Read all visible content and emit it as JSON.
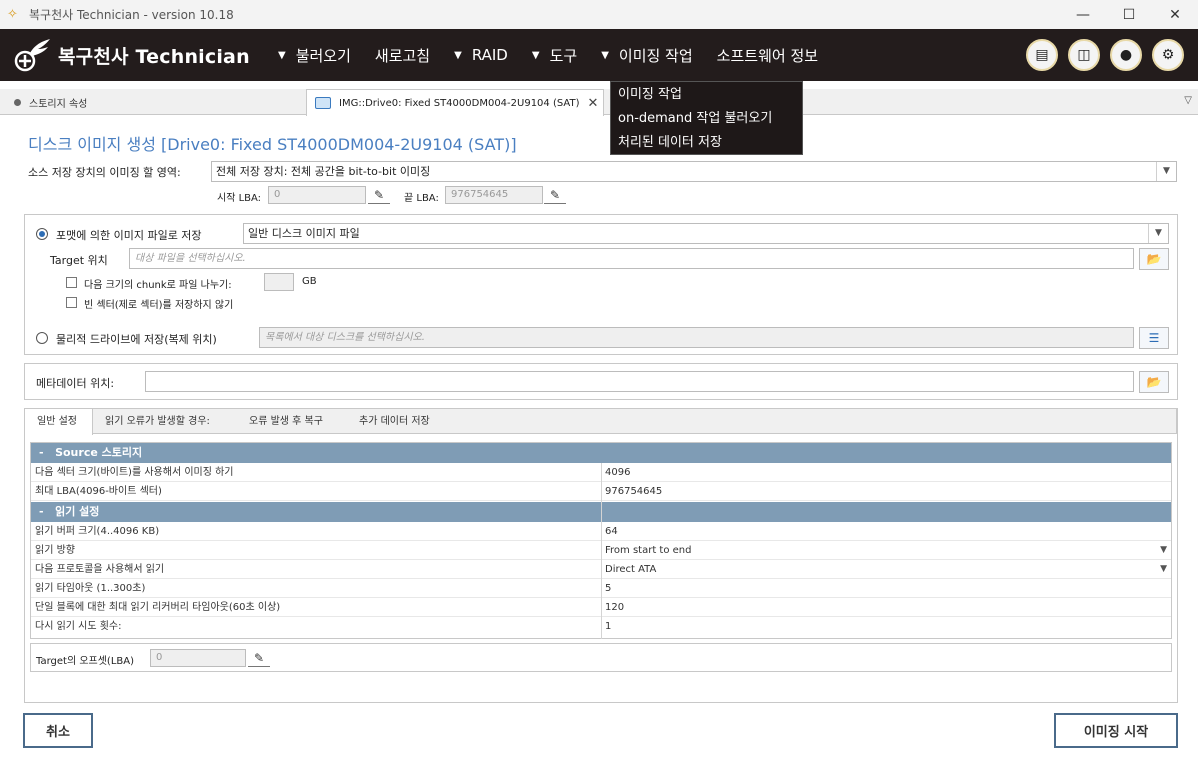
{
  "window": {
    "title": "복구천사 Technician - version 10.18"
  },
  "nav": {
    "brand": "복구천사 Technician",
    "menu": [
      {
        "label": "불러오기",
        "caret": true
      },
      {
        "label": "새로고침",
        "caret": false
      },
      {
        "label": "RAID",
        "caret": true
      },
      {
        "label": "도구",
        "caret": true
      },
      {
        "label": "이미징 작업",
        "caret": true
      },
      {
        "label": "소프트웨어 정보",
        "caret": false
      }
    ],
    "icons": [
      "book-icon",
      "panel-icon",
      "user-icon",
      "gear-icon"
    ]
  },
  "dropdown": {
    "items": [
      "이미징 작업",
      "on-demand 작업 불러오기",
      "처리된 데이터 저장"
    ]
  },
  "tabs": {
    "storage_props": "스토리지 속성",
    "image_tab": "IMG::Drive0: Fixed ST4000DM004-2U9104 (SAT)"
  },
  "page": {
    "title": "디스크 이미지 생성 [Drive0: Fixed ST4000DM004-2U9104 (SAT)]"
  },
  "source": {
    "label": "소스 저장 장치의 이미징 할 영역:",
    "value": "전체 저장 장치: 전체 공간을 bit-to-bit 이미징",
    "start_lba_label": "시작 LBA:",
    "start_lba": "0",
    "end_lba_label": "끝 LBA:",
    "end_lba": "976754645"
  },
  "save": {
    "format_label": "포맷에 의한 이미지 파일로 저장",
    "format_value": "일반 디스크 이미지 파일",
    "target_label": "Target 위치",
    "target_placeholder": "대상 파일을 선택하십시오.",
    "chunk_label": "다음 크기의 chunk로 파일 나누기:",
    "chunk_unit": "GB",
    "skip_empty_label": "빈 섹터(제로 섹터)를 저장하지 않기",
    "physical_label": "물리적 드라이브에 저장(복제 위치)",
    "physical_placeholder": "목록에서 대상 디스크를 선택하십시오."
  },
  "metadata": {
    "label": "메타데이터 위치:"
  },
  "settings_tabs": [
    "일반 설정",
    "읽기 오류가 발생할 경우:",
    "오류 발생 후 복구",
    "추가 데이터 저장"
  ],
  "props": {
    "source_section": "Source 스토리지",
    "source_rows": [
      {
        "key": "다음 섹터 크기(바이트)를 사용해서 이미징 하기",
        "value": "4096"
      },
      {
        "key": "최대 LBA(4096-바이트 섹터)",
        "value": "976754645"
      }
    ],
    "read_section": "읽기 설정",
    "read_rows": [
      {
        "key": "읽기 버퍼 크기(4..4096 KB)",
        "value": "64"
      },
      {
        "key": "읽기 방향",
        "value": "From start to end"
      },
      {
        "key": "다음 프로토콜을 사용해서 읽기",
        "value": "Direct ATA"
      },
      {
        "key": "읽기 타임아웃 (1..300초)",
        "value": "5"
      },
      {
        "key": "단일 블록에 대한 최대 읽기 리커버리 타임아웃(60초 이상)",
        "value": "120"
      },
      {
        "key": "다시 읽기 시도 횟수:",
        "value": "1"
      }
    ]
  },
  "offset": {
    "label": "Target의 오프셋(LBA)",
    "value": "0"
  },
  "buttons": {
    "cancel": "취소",
    "start": "이미징 시작"
  },
  "colors": {
    "nav_bg": "#231c1c",
    "accent_blue": "#4a7fc1",
    "section_header": "#7f9cb5"
  }
}
